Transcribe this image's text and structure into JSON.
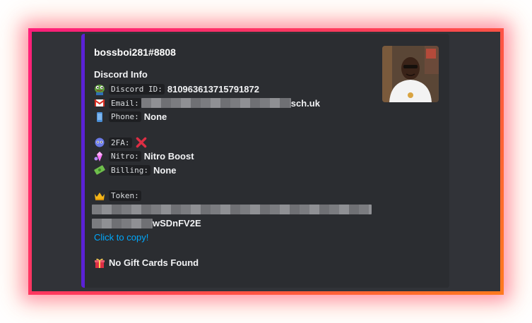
{
  "embed": {
    "author": "bossboi281#8808",
    "section_title": "Discord Info",
    "discord_id_label": "Discord ID:",
    "discord_id_value": "810963613715791872",
    "email_label": "Email:",
    "email_suffix": "sch.uk",
    "phone_label": "Phone:",
    "phone_value": "None",
    "twofa_label": "2FA:",
    "twofa_icon": "red-x-icon",
    "nitro_label": "Nitro:",
    "nitro_value": "Nitro Boost",
    "billing_label": "Billing:",
    "billing_value": "None",
    "token_label": "Token:",
    "token_suffix": "wSDnFV2E",
    "copy_link": "Click to copy!",
    "gift_text": "No Gift Cards Found"
  },
  "colors": {
    "accent_bar": "#5b21d6",
    "link": "#00a8fc",
    "frame_gradient_start": "#ff1f7a",
    "frame_gradient_end": "#ff7a1f"
  }
}
